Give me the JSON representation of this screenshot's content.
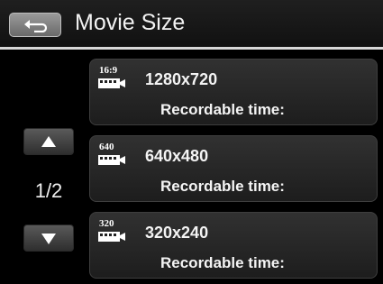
{
  "header": {
    "title": "Movie Size",
    "back_icon": "back-arrow-icon"
  },
  "nav": {
    "page_indicator": "1/2",
    "up_icon": "up-triangle-icon",
    "down_icon": "down-triangle-icon"
  },
  "items": [
    {
      "icon_label": "16:9",
      "resolution": "1280x720",
      "recordable": "Recordable time:"
    },
    {
      "icon_label": "640",
      "resolution": "640x480",
      "recordable": "Recordable time:"
    },
    {
      "icon_label": "320",
      "resolution": "320x240",
      "recordable": "Recordable time:"
    }
  ],
  "colors": {
    "background": "#000000",
    "header": "#151515",
    "divider": "#d8d8d8",
    "item": "#262626",
    "text": "#ffffff"
  }
}
